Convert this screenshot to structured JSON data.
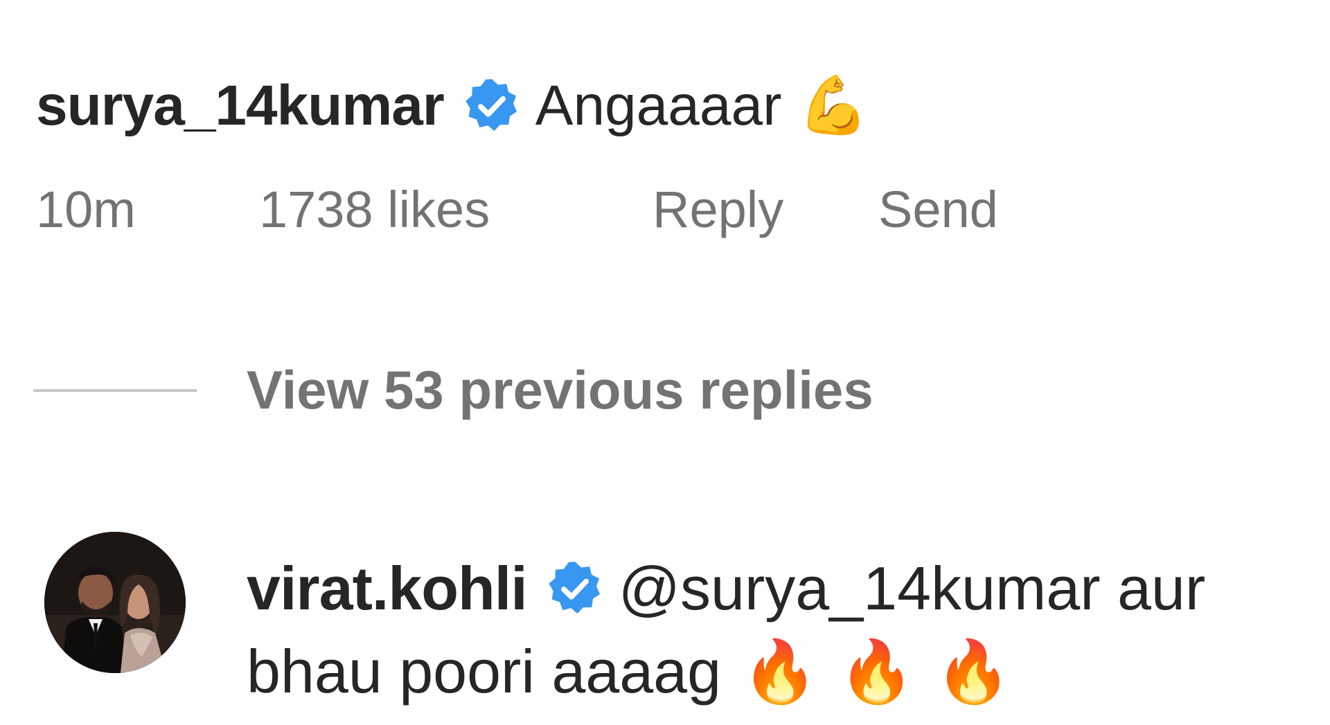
{
  "comment": {
    "username": "surya_14kumar",
    "text": "Angaaaar",
    "emoji": "💪",
    "time": "10m",
    "likes": "1738 likes",
    "reply_label": "Reply",
    "send_label": "Send"
  },
  "view_replies": {
    "label": "View 53 previous replies"
  },
  "reply": {
    "username": "virat.kohli",
    "mention": "@surya_14kumar aur",
    "text_line2": "bhau poori aaaag",
    "emojis": [
      "🔥",
      "🔥",
      "🔥"
    ]
  },
  "colors": {
    "verified_badge": "#3897f0",
    "text_primary": "#262626",
    "text_secondary": "#737373"
  }
}
